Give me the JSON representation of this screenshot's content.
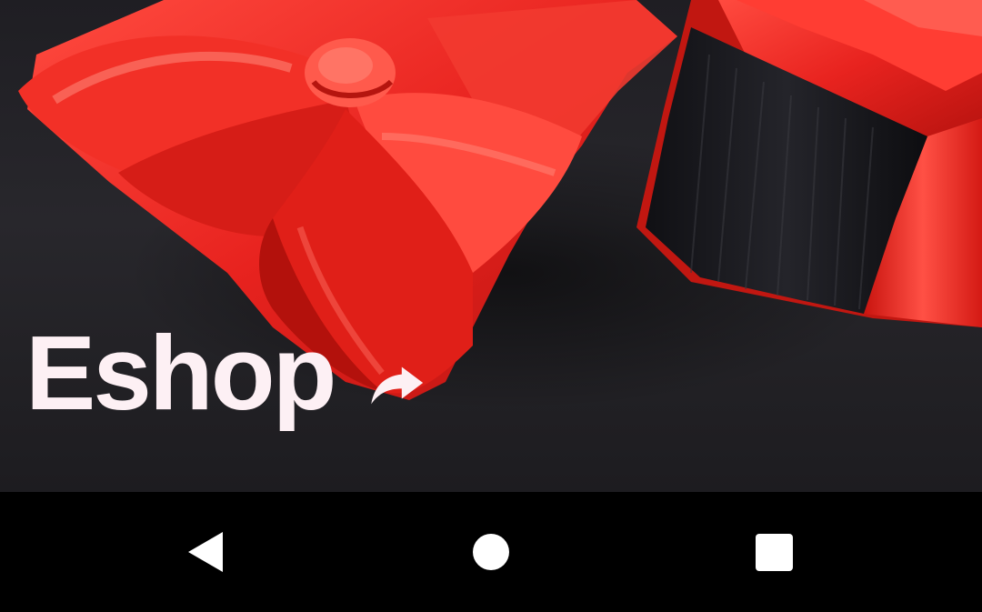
{
  "hero": {
    "title": "Eshop",
    "image_subject": "gift-boxes-photo",
    "share_icon": "share-arrow-icon"
  },
  "navigation_bar": {
    "back_icon": "back-triangle-icon",
    "home_icon": "home-circle-icon",
    "recents_icon": "recents-square-icon"
  },
  "colors": {
    "background_dark": "#242328",
    "ribbon_red": "#e82a2a",
    "title_text": "#fdf0f4",
    "nav_bar": "#000000",
    "nav_icons": "#ffffff"
  }
}
